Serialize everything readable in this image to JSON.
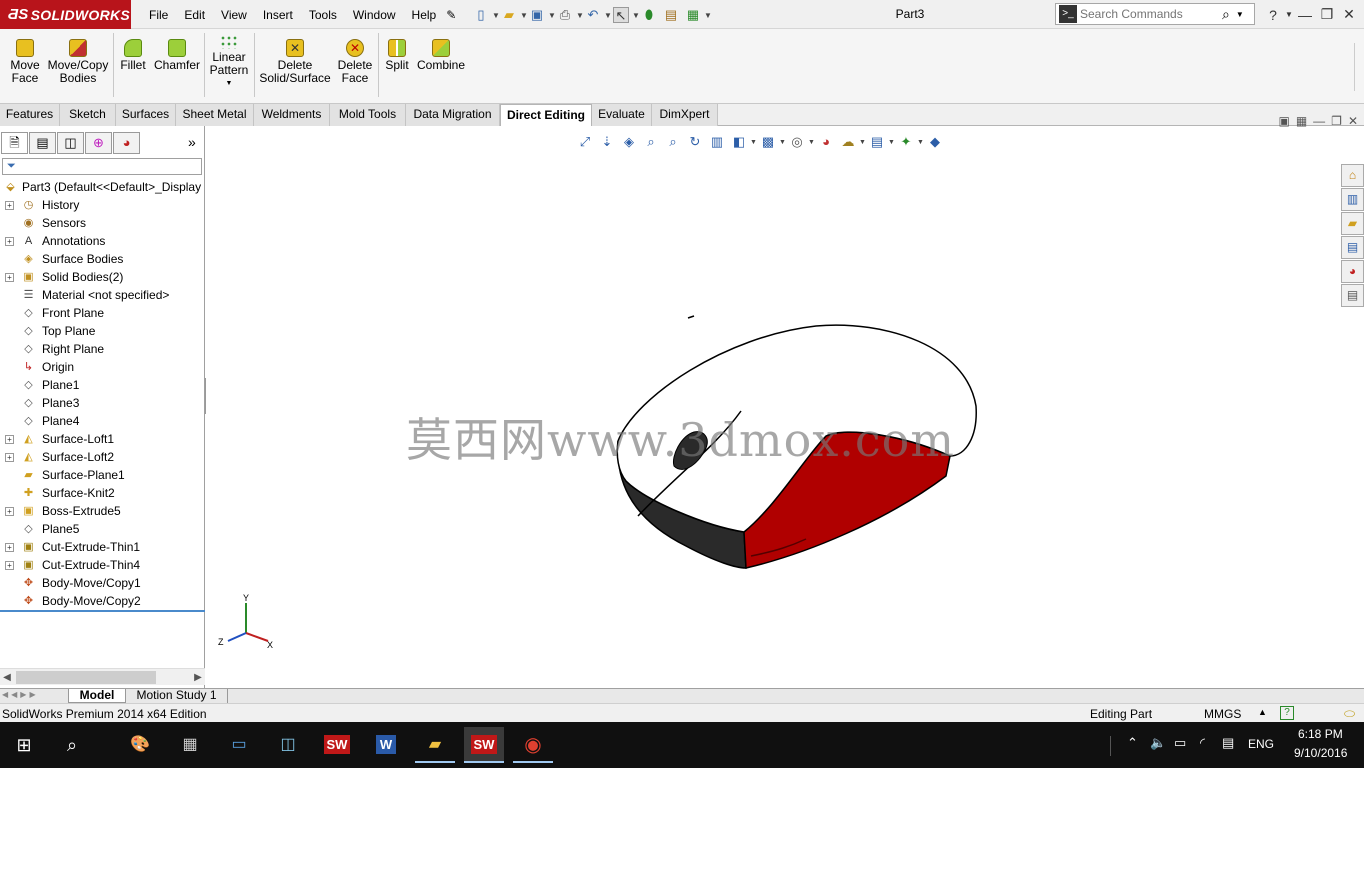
{
  "app": {
    "logo": "SOLIDWORKS",
    "document_title": "Part3"
  },
  "menu": [
    "File",
    "Edit",
    "View",
    "Insert",
    "Tools",
    "Window",
    "Help"
  ],
  "search": {
    "placeholder": "Search Commands"
  },
  "commands": [
    {
      "label": "Move\nFace",
      "icon": "move-face-icon"
    },
    {
      "label": "Move/Copy\nBodies",
      "icon": "move-copy-bodies-icon"
    },
    {
      "label": "Fillet",
      "icon": "fillet-icon"
    },
    {
      "label": "Chamfer",
      "icon": "chamfer-icon"
    },
    {
      "label": "Linear\nPattern",
      "icon": "linear-pattern-icon"
    },
    {
      "label": "Delete\nSolid/Surface",
      "icon": "delete-solid-icon"
    },
    {
      "label": "Delete\nFace",
      "icon": "delete-face-icon"
    },
    {
      "label": "Split",
      "icon": "split-icon"
    },
    {
      "label": "Combine",
      "icon": "combine-icon"
    }
  ],
  "tabs": [
    "Features",
    "Sketch",
    "Surfaces",
    "Sheet Metal",
    "Weldments",
    "Mold Tools",
    "Data Migration",
    "Direct Editing",
    "Evaluate",
    "DimXpert"
  ],
  "active_tab": "Direct Editing",
  "tree": {
    "root": "Part3  (Default<<Default>_Display",
    "items": [
      {
        "label": "History",
        "expandable": true
      },
      {
        "label": "Sensors",
        "expandable": false
      },
      {
        "label": "Annotations",
        "expandable": true
      },
      {
        "label": "Surface Bodies",
        "expandable": false
      },
      {
        "label": "Solid Bodies(2)",
        "expandable": true
      },
      {
        "label": "Material <not specified>",
        "expandable": false
      },
      {
        "label": "Front Plane",
        "expandable": false
      },
      {
        "label": "Top Plane",
        "expandable": false
      },
      {
        "label": "Right Plane",
        "expandable": false
      },
      {
        "label": "Origin",
        "expandable": false
      },
      {
        "label": "Plane1",
        "expandable": false
      },
      {
        "label": "Plane3",
        "expandable": false
      },
      {
        "label": "Plane4",
        "expandable": false
      },
      {
        "label": "Surface-Loft1",
        "expandable": true
      },
      {
        "label": "Surface-Loft2",
        "expandable": true
      },
      {
        "label": "Surface-Plane1",
        "expandable": false
      },
      {
        "label": "Surface-Knit2",
        "expandable": false
      },
      {
        "label": "Boss-Extrude5",
        "expandable": true
      },
      {
        "label": "Plane5",
        "expandable": false
      },
      {
        "label": "Cut-Extrude-Thin1",
        "expandable": true
      },
      {
        "label": "Cut-Extrude-Thin4",
        "expandable": true
      },
      {
        "label": "Body-Move/Copy1",
        "expandable": false
      },
      {
        "label": "Body-Move/Copy2",
        "expandable": false
      }
    ]
  },
  "watermark": "莫西网www.3dmox.com",
  "triad": {
    "x": "X",
    "y": "Y",
    "z": "Z"
  },
  "model_tabs": [
    "Model",
    "Motion Study 1"
  ],
  "status": {
    "edition": "SolidWorks Premium 2014 x64 Edition",
    "mode": "Editing Part",
    "units": "MMGS"
  },
  "taskbar": {
    "language": "ENG",
    "time": "6:18 PM",
    "date": "9/10/2016"
  },
  "colors": {
    "accent_red": "#b8141b",
    "mouse_red": "#b00000",
    "mouse_dark": "#2a2a2a"
  }
}
